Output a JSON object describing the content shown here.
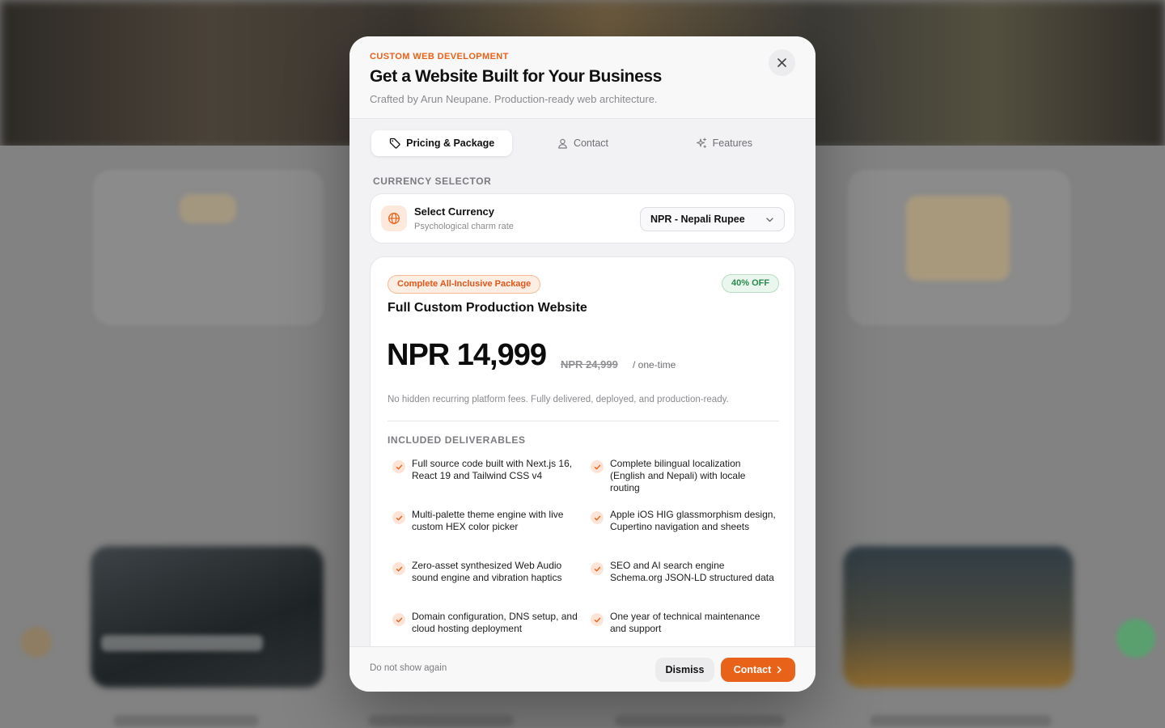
{
  "modal": {
    "eyebrow": "CUSTOM WEB DEVELOPMENT",
    "title": "Get a Website Built for Your Business",
    "subtitle": "Crafted by Arun Neupane. Production-ready web architecture."
  },
  "tabs": [
    {
      "label": "Pricing & Package",
      "icon": "tag-icon",
      "active": true
    },
    {
      "label": "Contact",
      "icon": "user-icon",
      "active": false
    },
    {
      "label": "Features",
      "icon": "sparkle-icon",
      "active": false
    }
  ],
  "currency": {
    "section_label": "CURRENCY SELECTOR",
    "title": "Select Currency",
    "subtitle": "Psychological charm rate",
    "selected": "NPR - Nepali Rupee"
  },
  "package": {
    "badge": "Complete All-Inclusive Package",
    "discount": "40% OFF",
    "title": "Full Custom Production Website",
    "price": "NPR 14,999",
    "original_price": "NPR 24,999",
    "billing": "/ one-time",
    "note": "No hidden recurring platform fees. Fully delivered, deployed, and production-ready.",
    "deliverables_label": "INCLUDED DELIVERABLES",
    "deliverables": [
      "Full source code built with Next.js 16, React 19 and Tailwind CSS v4",
      "Complete bilingual localization (English and Nepali) with locale routing",
      "Multi-palette theme engine with live custom HEX color picker",
      "Apple iOS HIG glassmorphism design, Cupertino navigation and sheets",
      "Zero-asset synthesized Web Audio sound engine and vibration haptics",
      "SEO and AI search engine Schema.org JSON-LD structured data",
      "Domain configuration, DNS setup, and cloud hosting deployment",
      "One year of technical maintenance and support"
    ]
  },
  "footer": {
    "dont_show": "Do not show again",
    "dismiss": "Dismiss",
    "contact": "Contact"
  },
  "colors": {
    "accent": "#e8621a",
    "discount_green": "#2a8a4c"
  }
}
